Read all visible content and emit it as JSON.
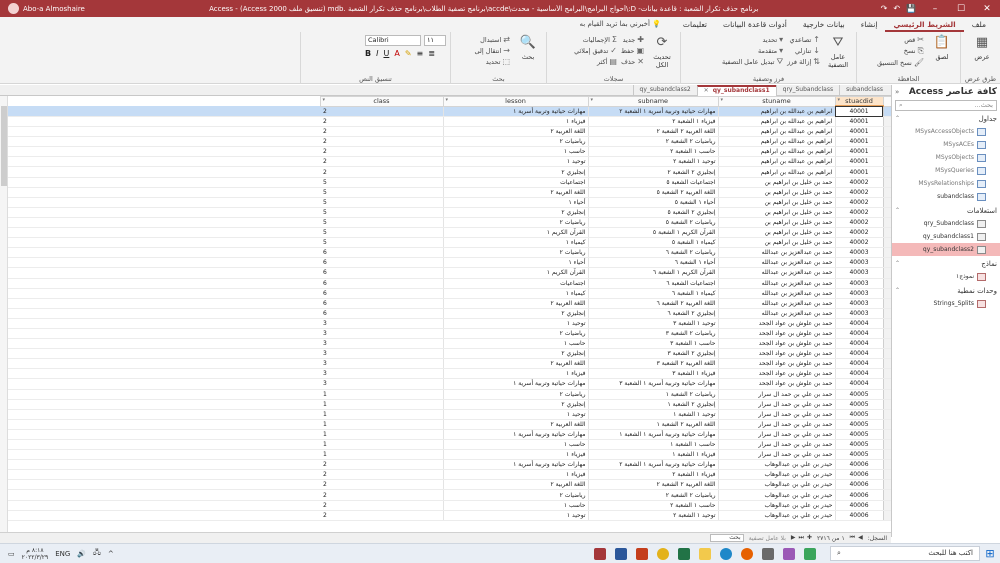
{
  "titlebar": {
    "title": "برنامج حذف تكرار الشعبة : قاعدة بيانات- D:\\أحواج البرامج\\البرامج الأساسية - محدث\\accde\\برنامج تصفية الطلاب\\برنامج حذف تكرار الشعبة .mdb (تنسيق ملف Access 2000) - Access",
    "user": "Abo-a Almoshaire",
    "min": "–",
    "max": "☐",
    "close": "✕"
  },
  "tabs": {
    "items": [
      "ملف",
      "الشريط الرئيسي",
      "إنشاء",
      "بيانات خارجية",
      "أدوات قاعدة البيانات",
      "تعليمات"
    ],
    "search": "أخبرني بما تريد القيام به"
  },
  "ribbon": {
    "views": {
      "label": "طرق عرض",
      "view": "عرض"
    },
    "clipboard": {
      "label": "الحافظة",
      "paste": "لصق",
      "cut": "قص",
      "copy": "نسخ",
      "painter": "نسخ التنسيق"
    },
    "sort": {
      "label": "فرز وتصفية",
      "filter": "عامل التصفية",
      "asc": "تصاعدي",
      "desc": "تنازلي",
      "remove": "إزالة فرز",
      "selection": "تحديد",
      "advanced": "متقدمة",
      "toggle": "تبديل عامل التصفية"
    },
    "records": {
      "label": "سجلات",
      "refresh": "تحديث الكل",
      "new": "جديد",
      "save": "حفظ",
      "delete": "حذف",
      "totals": "الإجماليات",
      "spelling": "تدقيق إملائي",
      "more": "أكثر"
    },
    "find": {
      "label": "بحث",
      "find": "بحث",
      "replace": "استبدال",
      "goto": "انتقال إلى",
      "select": "تحديد"
    },
    "text": {
      "label": "تنسيق النص",
      "font": "Calibri",
      "size": "١١"
    }
  },
  "doctabs": [
    {
      "label": "subandclass",
      "active": false
    },
    {
      "label": "qry_Subandclass",
      "active": false
    },
    {
      "label": "qy_subandclass1",
      "active": true
    },
    {
      "label": "qy_subandclass2",
      "active": false
    }
  ],
  "table": {
    "columns": [
      "stuacdid",
      "stuname",
      "subname",
      "lesson",
      "class"
    ],
    "rows": [
      [
        "40001",
        "ابراهيم بن عبدالله بن ابراهيم",
        "مهارات حياتية وتربية أسرية ١ الشعبة ٢",
        "مهارات حياتية وتربية أسرية ١",
        "2"
      ],
      [
        "40001",
        "ابراهيم بن عبدالله بن ابراهيم",
        "فيزياء ١ الشعبة ٢",
        "فيزياء ١",
        "2"
      ],
      [
        "40001",
        "ابراهيم بن عبدالله بن ابراهيم",
        "اللغة العربية ٢ الشعبة ٢",
        "اللغة العربية ٢",
        "2"
      ],
      [
        "40001",
        "ابراهيم بن عبدالله بن ابراهيم",
        "رياضيات ٢ الشعبة ٢",
        "رياضيات ٢",
        "2"
      ],
      [
        "40001",
        "ابراهيم بن عبدالله بن ابراهيم",
        "حاسب ١ الشعبة ٢",
        "حاسب ١",
        "2"
      ],
      [
        "40001",
        "ابراهيم بن عبدالله بن ابراهيم",
        "توحيد ١ الشعبة ٢",
        "توحيد ١",
        "2"
      ],
      [
        "40001",
        "ابراهيم بن عبدالله بن ابراهيم",
        "إنجليزي ٢ الشعبة ٢",
        "إنجليزي ٢",
        "2"
      ],
      [
        "40002",
        "حمد بن خليل بن ابراهيم بن",
        "اجتماعيات الشعبة ٥",
        "اجتماعيات",
        "5"
      ],
      [
        "40002",
        "حمد بن خليل بن ابراهيم بن",
        "اللغة العربية ٢ الشعبة ٥",
        "اللغة العربية ٢",
        "5"
      ],
      [
        "40002",
        "حمد بن خليل بن ابراهيم بن",
        "أحياء ١ الشعبة ٥",
        "أحياء ١",
        "5"
      ],
      [
        "40002",
        "حمد بن خليل بن ابراهيم بن",
        "إنجليزي ٢ الشعبة ٥",
        "إنجليزي ٢",
        "5"
      ],
      [
        "40002",
        "حمد بن خليل بن ابراهيم بن",
        "رياضيات ٢ الشعبة ٥",
        "رياضيات ٢",
        "5"
      ],
      [
        "40002",
        "حمد بن خليل بن ابراهيم بن",
        "القرآن الكريم ١ الشعبة ٥",
        "القرآن الكريم ١",
        "5"
      ],
      [
        "40002",
        "حمد بن خليل بن ابراهيم بن",
        "كيمياء ١ الشعبة ٥",
        "كيمياء ١",
        "5"
      ],
      [
        "40003",
        "حمد بن عبدالعزيز بن عبدالله",
        "رياضيات ٢ الشعبة ٦",
        "رياضيات ٢",
        "6"
      ],
      [
        "40003",
        "حمد بن عبدالعزيز بن عبدالله",
        "أحياء ١ الشعبة ٦",
        "أحياء ١",
        "6"
      ],
      [
        "40003",
        "حمد بن عبدالعزيز بن عبدالله",
        "القرآن الكريم ١ الشعبة ٦",
        "القرآن الكريم ١",
        "6"
      ],
      [
        "40003",
        "حمد بن عبدالعزيز بن عبدالله",
        "اجتماعيات الشعبة ٦",
        "اجتماعيات",
        "6"
      ],
      [
        "40003",
        "حمد بن عبدالعزيز بن عبدالله",
        "كيمياء ١ الشعبة ٦",
        "كيمياء ١",
        "6"
      ],
      [
        "40003",
        "حمد بن عبدالعزيز بن عبدالله",
        "اللغة العربية ٢ الشعبة ٦",
        "اللغة العربية ٢",
        "6"
      ],
      [
        "40003",
        "حمد بن عبدالعزيز بن عبدالله",
        "إنجليزي ٢ الشعبة ٦",
        "إنجليزي ٢",
        "6"
      ],
      [
        "40004",
        "حمد بن علوش بن عواد الجحد",
        "توحيد ١ الشعبة ٣",
        "توحيد ١",
        "3"
      ],
      [
        "40004",
        "حمد بن علوش بن عواد الجحد",
        "رياضيات ٢ الشعبة ٣",
        "رياضيات ٢",
        "3"
      ],
      [
        "40004",
        "حمد بن علوش بن عواد الجحد",
        "حاسب ١ الشعبة ٣",
        "حاسب ١",
        "3"
      ],
      [
        "40004",
        "حمد بن علوش بن عواد الجحد",
        "إنجليزي ٢ الشعبة ٣",
        "إنجليزي ٢",
        "3"
      ],
      [
        "40004",
        "حمد بن علوش بن عواد الجحد",
        "اللغة العربية ٢ الشعبة ٣",
        "اللغة العربية ٢",
        "3"
      ],
      [
        "40004",
        "حمد بن علوش بن عواد الجحد",
        "فيزياء ١ الشعبة ٣",
        "فيزياء ١",
        "3"
      ],
      [
        "40004",
        "حمد بن علوش بن عواد الجحد",
        "مهارات حياتية وتربية أسرية ١ الشعبة ٣",
        "مهارات حياتية وتربية أسرية ١",
        "3"
      ],
      [
        "40005",
        "حمد بن علي بن حمد ال سرار",
        "رياضيات ٢ الشعبة ١",
        "رياضيات ٢",
        "1"
      ],
      [
        "40005",
        "حمد بن علي بن حمد ال سرار",
        "إنجليزي ٢ الشعبة ١",
        "إنجليزي ٢",
        "1"
      ],
      [
        "40005",
        "حمد بن علي بن حمد ال سرار",
        "توحيد ١ الشعبة ١",
        "توحيد ١",
        "1"
      ],
      [
        "40005",
        "حمد بن علي بن حمد ال سرار",
        "اللغة العربية ٢ الشعبة ١",
        "اللغة العربية ٢",
        "1"
      ],
      [
        "40005",
        "حمد بن علي بن حمد ال سرار",
        "مهارات حياتية وتربية أسرية ١ الشعبة ١",
        "مهارات حياتية وتربية أسرية ١",
        "1"
      ],
      [
        "40005",
        "حمد بن علي بن حمد ال سرار",
        "حاسب ١ الشعبة ١",
        "حاسب ١",
        "1"
      ],
      [
        "40005",
        "حمد بن علي بن حمد ال سرار",
        "فيزياء ١ الشعبة ١",
        "فيزياء ١",
        "1"
      ],
      [
        "40006",
        "حيدر بن علي بن عبدالوهاب",
        "مهارات حياتية وتربية أسرية ١ الشعبة ٢",
        "مهارات حياتية وتربية أسرية ١",
        "2"
      ],
      [
        "40006",
        "حيدر بن علي بن عبدالوهاب",
        "فيزياء ١ الشعبة ٢",
        "فيزياء ١",
        "2"
      ],
      [
        "40006",
        "حيدر بن علي بن عبدالوهاب",
        "اللغة العربية ٢ الشعبة ٢",
        "اللغة العربية ٢",
        "2"
      ],
      [
        "40006",
        "حيدر بن علي بن عبدالوهاب",
        "رياضيات ٢ الشعبة ٢",
        "رياضيات ٢",
        "2"
      ],
      [
        "40006",
        "حيدر بن علي بن عبدالوهاب",
        "حاسب ١ الشعبة ٢",
        "حاسب ١",
        "2"
      ],
      [
        "40006",
        "حيدر بن علي بن عبدالوهاب",
        "توحيد ١ الشعبة ٢",
        "توحيد ١",
        "2"
      ]
    ]
  },
  "navpane": {
    "title": "كافة عناصر Access",
    "search_placeholder": "بحث...",
    "sections": [
      {
        "label": "جداول",
        "items": [
          {
            "label": "MSysAccessObjects",
            "type": "table",
            "dim": true
          },
          {
            "label": "MSysACEs",
            "type": "table",
            "dim": true
          },
          {
            "label": "MSysObjects",
            "type": "table",
            "dim": true
          },
          {
            "label": "MSysQueries",
            "type": "table",
            "dim": true
          },
          {
            "label": "MSysRelationships",
            "type": "table",
            "dim": true
          },
          {
            "label": "subandclass",
            "type": "table",
            "dim": false
          }
        ]
      },
      {
        "label": "استعلامات",
        "items": [
          {
            "label": "qry_Subandclass",
            "type": "query",
            "dim": false
          },
          {
            "label": "qy_subandclass1",
            "type": "query",
            "dim": false
          },
          {
            "label": "qy_subandclass2",
            "type": "query",
            "dim": false,
            "selected": true
          }
        ]
      },
      {
        "label": "نماذج",
        "items": [
          {
            "label": "نموذج١",
            "type": "form",
            "dim": false
          }
        ]
      },
      {
        "label": "وحدات نمطية",
        "items": [
          {
            "label": "Strings_Splits",
            "type": "module",
            "dim": false
          }
        ]
      }
    ]
  },
  "recnav": {
    "label": "السجل:",
    "position": "١ من ٢٧١٦",
    "filter": "بلا عامل تصفية",
    "search": "بحث"
  },
  "taskbar": {
    "search": "اكتب هنا للبحث",
    "time": "٨:١٨ م",
    "date": "٢٠٢٢/٣/٢٩",
    "lang": "ENG"
  },
  "colors": {
    "accent": "#a4373a",
    "selected_row": "#c6dcf5",
    "nav_selected": "#f4b9b9"
  }
}
